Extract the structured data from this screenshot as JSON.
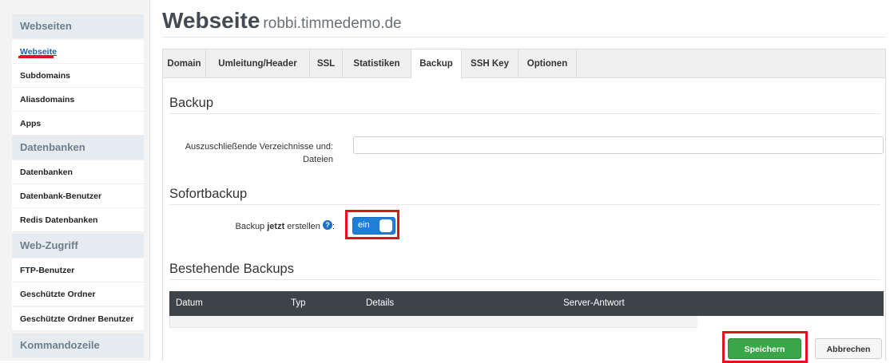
{
  "sidebar": {
    "sections": [
      {
        "header": "Webseiten",
        "items": [
          "Webseite",
          "Subdomains",
          "Aliasdomains",
          "Apps"
        ]
      },
      {
        "header": "Datenbanken",
        "items": [
          "Datenbanken",
          "Datenbank-Benutzer",
          "Redis Datenbanken"
        ]
      },
      {
        "header": "Web-Zugriff",
        "items": [
          "FTP-Benutzer",
          "Geschützte Ordner",
          "Geschützte Ordner Benutzer"
        ]
      },
      {
        "header": "Kommandozeile",
        "items": []
      }
    ],
    "active_item": "Webseite"
  },
  "page": {
    "title": "Webseite",
    "subtitle": "robbi.timmedemo.de"
  },
  "tabs": [
    "Domain",
    "Umleitung/Header",
    "SSL",
    "Statistiken",
    "Backup",
    "SSH Key",
    "Optionen"
  ],
  "active_tab": "Backup",
  "backup": {
    "heading": "Backup",
    "exclude_label_line1": "Auszuschließende Verzeichnisse und:",
    "exclude_label_line2": "Dateien",
    "exclude_value": ""
  },
  "sofort": {
    "heading": "Sofortbackup",
    "label_prefix": "Backup ",
    "label_bold": "jetzt",
    "label_suffix": " erstellen",
    "help_icon": "?",
    "label_colon": ":",
    "toggle_text": "ein",
    "toggle_on": true
  },
  "existing": {
    "heading": "Bestehende Backups",
    "columns": [
      "Datum",
      "Typ",
      "Details",
      "Server-Antwort"
    ]
  },
  "buttons": {
    "save": "Speichern",
    "cancel": "Abbrechen"
  },
  "colors": {
    "highlight": "#e0141e",
    "primary": "#1f7ed6",
    "save": "#39a64a",
    "table_header": "#3d4349"
  }
}
